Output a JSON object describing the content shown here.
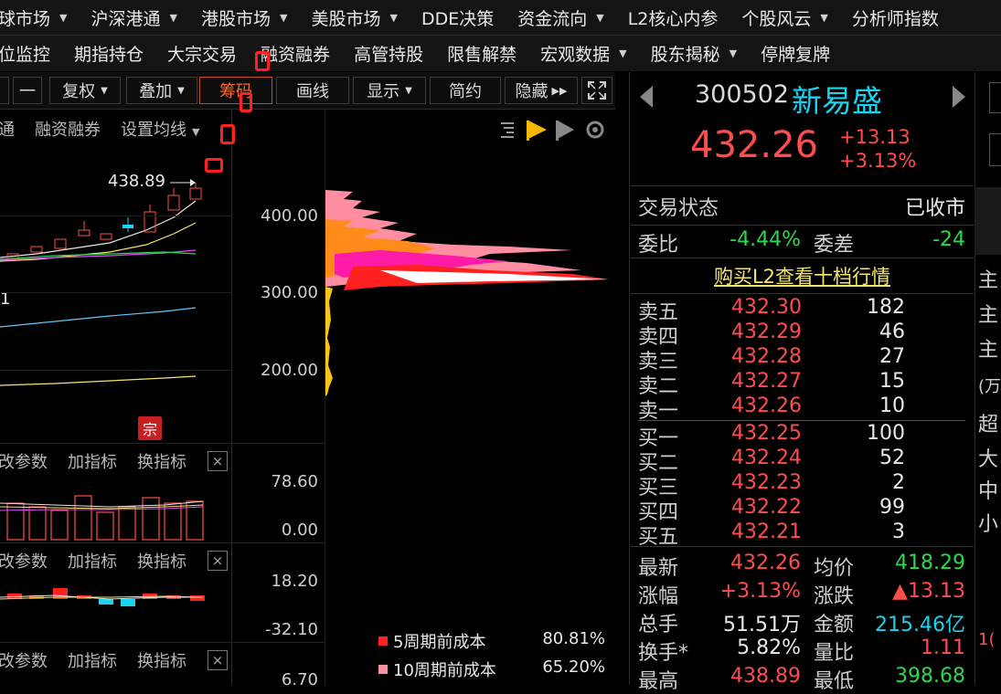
{
  "menu": {
    "row1": [
      {
        "label": "球市场",
        "arrow": true
      },
      {
        "label": "沪深港通",
        "arrow": true
      },
      {
        "label": "港股市场",
        "arrow": true
      },
      {
        "label": "美股市场",
        "arrow": true
      },
      {
        "label": "DDE决策",
        "arrow": false
      },
      {
        "label": "资金流向",
        "arrow": true
      },
      {
        "label": "L2核心内参",
        "arrow": false
      },
      {
        "label": "个股风云",
        "arrow": true
      },
      {
        "label": "分析师指数",
        "arrow": false
      }
    ],
    "row2": [
      {
        "label": "位监控",
        "arrow": false
      },
      {
        "label": "期指持仓",
        "arrow": false
      },
      {
        "label": "大宗交易",
        "arrow": false
      },
      {
        "label": "融资融券",
        "arrow": false
      },
      {
        "label": "高管持股",
        "arrow": false
      },
      {
        "label": "限售解禁",
        "arrow": false
      },
      {
        "label": "宏观数据",
        "arrow": true
      },
      {
        "label": "股东揭秘",
        "arrow": true
      },
      {
        "label": "停牌复牌",
        "arrow": false
      }
    ]
  },
  "toolbar": {
    "dash": "一",
    "fuquan": "复权",
    "diejia": "叠加",
    "chouma": "筹码",
    "huaxian": "画线",
    "xianshi": "显示",
    "jianyue": "简约",
    "yincang": "隐藏"
  },
  "chart": {
    "subtabs": [
      "通",
      "融资融券",
      "设置均线"
    ],
    "peak_label": "438.89",
    "left_label": "1",
    "price_axis": [
      "400.00",
      "300.00",
      "200.00"
    ],
    "zong_badge": "宗",
    "vol_axis": [
      "78.60",
      "0.00"
    ],
    "macd_axis": [
      "18.20",
      "-32.10"
    ],
    "third_axis": [
      "6.70"
    ],
    "indicator_bar": {
      "p1": "改参数",
      "p2": "加指标",
      "p3": "换指标",
      "close": "×"
    },
    "legend": [
      {
        "label": "5周期前成本",
        "value": "80.81%",
        "color": "#ff2020"
      },
      {
        "label": "10周期前成本",
        "value": "65.20%",
        "color": "#ff8ea0"
      }
    ]
  },
  "stock": {
    "code": "300502",
    "name": "新易盛",
    "price": "432.26",
    "change": "+13.13",
    "change_pct": "+3.13%",
    "status_label": "交易状态",
    "status_value": "已收市",
    "weibi_label": "委比",
    "weibi_value": "-4.44%",
    "weicha_label": "委差",
    "weicha_value": "-24",
    "l2_link": "购买L2查看十档行情"
  },
  "orderbook": {
    "asks": [
      {
        "label": "卖五",
        "price": "432.30",
        "vol": "182"
      },
      {
        "label": "卖四",
        "price": "432.29",
        "vol": "46"
      },
      {
        "label": "卖三",
        "price": "432.28",
        "vol": "27"
      },
      {
        "label": "卖二",
        "price": "432.27",
        "vol": "15"
      },
      {
        "label": "卖一",
        "price": "432.26",
        "vol": "10"
      }
    ],
    "bids": [
      {
        "label": "买一",
        "price": "432.25",
        "vol": "100"
      },
      {
        "label": "买二",
        "price": "432.24",
        "vol": "52"
      },
      {
        "label": "买三",
        "price": "432.23",
        "vol": "2"
      },
      {
        "label": "买四",
        "price": "432.22",
        "vol": "99"
      },
      {
        "label": "买五",
        "price": "432.21",
        "vol": "3"
      }
    ]
  },
  "stats": [
    {
      "l1": "最新",
      "v1": "432.26",
      "c1": "red",
      "l2": "均价",
      "v2": "418.29",
      "c2": "green"
    },
    {
      "l1": "涨幅",
      "v1": "+3.13%",
      "c1": "red",
      "l2": "涨跌",
      "v2": "▲13.13",
      "c2": "red"
    },
    {
      "l1": "总手",
      "v1": "51.51万",
      "c1": "white",
      "l2": "金额",
      "v2": "215.46亿",
      "c2": "cyan"
    },
    {
      "l1": "换手*",
      "v1": "5.82%",
      "c1": "white",
      "l2": "量比",
      "v2": "1.11",
      "c2": "red"
    },
    {
      "l1": "最高",
      "v1": "438.89",
      "c1": "red",
      "l2": "最低",
      "v2": "398.68",
      "c2": "green"
    }
  ],
  "farright": [
    "主",
    "主",
    "主",
    "(万",
    "超",
    "大",
    "中",
    "小",
    "1("
  ]
}
